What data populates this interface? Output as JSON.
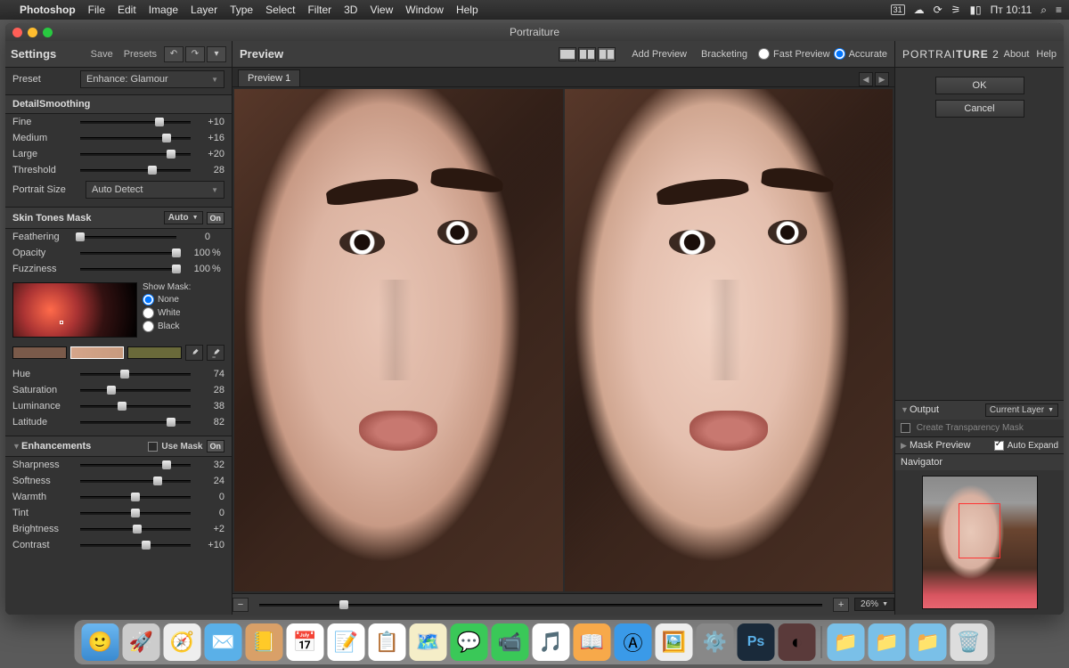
{
  "menubar": {
    "app": "Photoshop",
    "items": [
      "File",
      "Edit",
      "Image",
      "Layer",
      "Type",
      "Select",
      "Filter",
      "3D",
      "View",
      "Window",
      "Help"
    ],
    "day": "31",
    "clock": "Пт 10:11"
  },
  "window": {
    "title": "Portraiture"
  },
  "settings": {
    "title": "Settings",
    "save": "Save",
    "presets": "Presets",
    "preset_label": "Preset",
    "preset_value": "Enhance: Glamour",
    "detail_smoothing": {
      "title": "DetailSmoothing",
      "fine": {
        "label": "Fine",
        "value": "+10",
        "pos": 72
      },
      "medium": {
        "label": "Medium",
        "value": "+16",
        "pos": 78
      },
      "large": {
        "label": "Large",
        "value": "+20",
        "pos": 82
      },
      "threshold": {
        "label": "Threshold",
        "value": "28",
        "pos": 65
      },
      "portrait_size_label": "Portrait Size",
      "portrait_size_value": "Auto Detect"
    },
    "skin_tones": {
      "title": "Skin Tones Mask",
      "mode": "Auto",
      "on": "On",
      "feathering": {
        "label": "Feathering",
        "value": "0",
        "pos": 0
      },
      "opacity": {
        "label": "Opacity",
        "value": "100",
        "unit": "%",
        "pos": 100
      },
      "fuzziness": {
        "label": "Fuzziness",
        "value": "100",
        "unit": "%",
        "pos": 100
      },
      "show_mask": "Show Mask:",
      "mask_none": "None",
      "mask_white": "White",
      "mask_black": "Black",
      "hue": {
        "label": "Hue",
        "value": "74",
        "pos": 40
      },
      "saturation": {
        "label": "Saturation",
        "value": "28",
        "pos": 28
      },
      "luminance": {
        "label": "Luminance",
        "value": "38",
        "pos": 38
      },
      "latitude": {
        "label": "Latitude",
        "value": "82",
        "pos": 82
      }
    },
    "enhancements": {
      "title": "Enhancements",
      "use_mask": "Use Mask",
      "on": "On",
      "sharpness": {
        "label": "Sharpness",
        "value": "32",
        "pos": 78
      },
      "softness": {
        "label": "Softness",
        "value": "24",
        "pos": 70
      },
      "warmth": {
        "label": "Warmth",
        "value": "0",
        "pos": 50
      },
      "tint": {
        "label": "Tint",
        "value": "0",
        "pos": 50
      },
      "brightness": {
        "label": "Brightness",
        "value": "+2",
        "pos": 52
      },
      "contrast": {
        "label": "Contrast",
        "value": "+10",
        "pos": 60
      }
    }
  },
  "preview": {
    "title": "Preview",
    "add_preview": "Add Preview",
    "bracketing": "Bracketing",
    "fast": "Fast Preview",
    "accurate": "Accurate",
    "tab1": "Preview 1",
    "zoom": "26%"
  },
  "right": {
    "brand_a": "PORTRAI",
    "brand_b": "TURE",
    "brand_n": "2",
    "about": "About",
    "help": "Help",
    "ok": "OK",
    "cancel": "Cancel",
    "output": "Output",
    "output_value": "Current Layer",
    "create_mask": "Create Transparency Mask",
    "mask_preview": "Mask Preview",
    "auto_expand": "Auto Expand",
    "navigator": "Navigator"
  },
  "dock": [
    "finder",
    "launchpad",
    "safari",
    "mail",
    "contacts",
    "calendar",
    "notes",
    "reminders",
    "maps",
    "messages",
    "facetime",
    "itunes",
    "ibooks",
    "appstore",
    "preview",
    "settings"
  ],
  "dock_right": [
    "photoshop",
    "imagenomic",
    "folder1",
    "folder2",
    "folder3",
    "trash"
  ]
}
